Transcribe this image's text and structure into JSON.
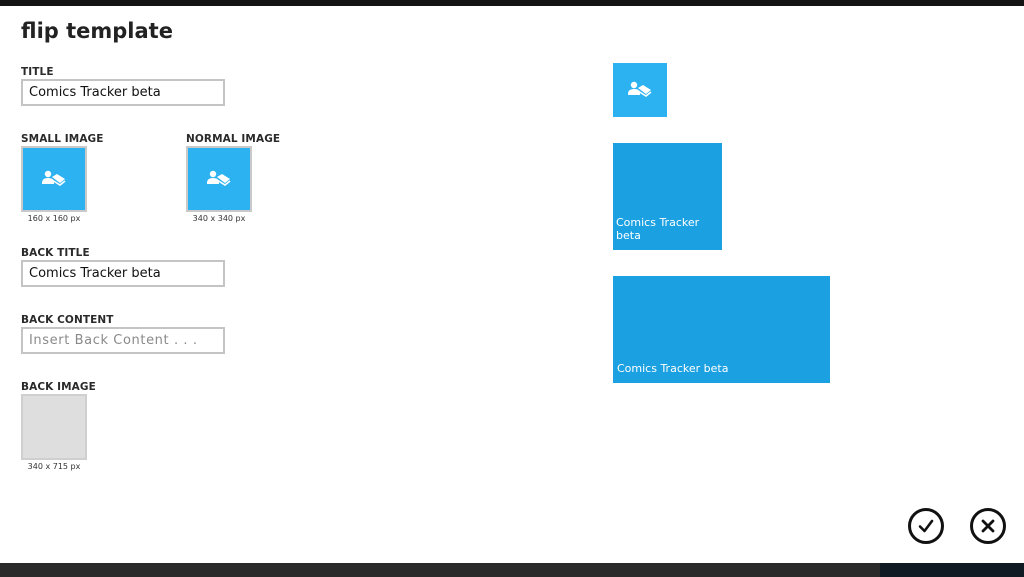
{
  "page": {
    "title": "flip template"
  },
  "fields": {
    "title": {
      "label": "TITLE",
      "value": "Comics Tracker beta"
    },
    "small_image": {
      "label": "SMALL IMAGE",
      "size": "160 x 160 px",
      "icon": "app-logo-icon"
    },
    "normal_image": {
      "label": "NORMAL IMAGE",
      "size": "340 x 340 px",
      "icon": "app-logo-icon"
    },
    "back_title": {
      "label": "BACK TITLE",
      "value": "Comics Tracker beta"
    },
    "back_content": {
      "label": "BACK CONTENT",
      "value": "",
      "placeholder": "Insert Back Content . . ."
    },
    "back_image": {
      "label": "BACK IMAGE",
      "size": "340 x 715 px"
    }
  },
  "preview": {
    "small_tile_icon": "app-logo-icon",
    "medium_tile_text": "Comics Tracker beta",
    "wide_tile_text": "Comics Tracker beta"
  },
  "actions": {
    "confirm_icon": "check-circle-icon",
    "cancel_icon": "close-circle-icon"
  },
  "colors": {
    "tile_light": "#2cb2f0",
    "tile_accent": "#1ba0e2",
    "input_border": "#c4c4c4"
  }
}
